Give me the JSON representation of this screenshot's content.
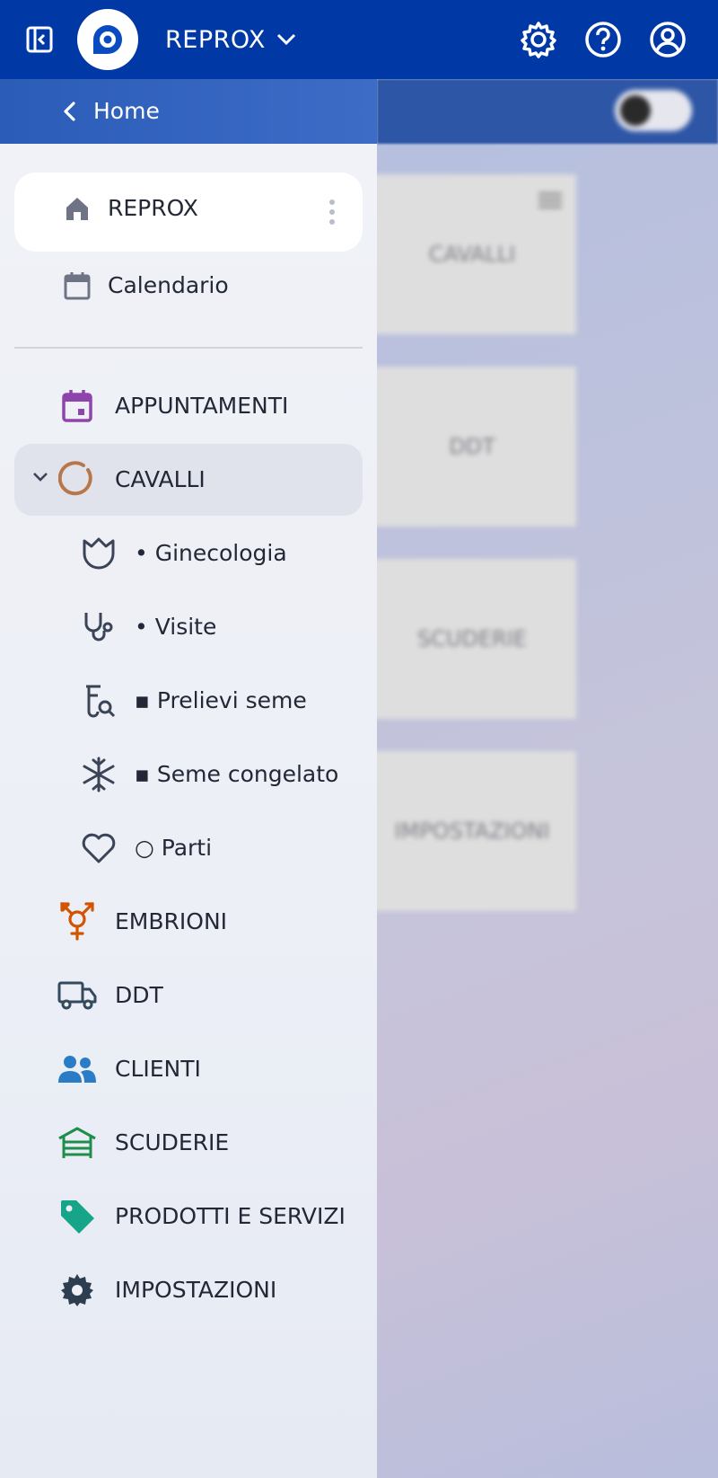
{
  "topbar": {
    "app_name": "REPROX",
    "icons": [
      "sidebar-collapse-icon",
      "logo-icon",
      "chevron-down-icon",
      "gear-icon",
      "help-icon",
      "account-icon"
    ]
  },
  "drawer": {
    "header_label": "Home",
    "pinned": [
      {
        "label": "REPROX",
        "icon": "home-icon"
      },
      {
        "label": "Calendario",
        "icon": "calendar-icon"
      }
    ],
    "items": [
      {
        "label": "APPUNTAMENTI",
        "icon": "calendar-event-icon",
        "color": "#8e44ad"
      },
      {
        "label": "CAVALLI",
        "icon": "horseshoe-icon",
        "color": "#b7774a",
        "expanded": true
      },
      {
        "label": "• Ginecologia",
        "icon": "tulip-icon",
        "color": "#3a4456"
      },
      {
        "label": "• Visite",
        "icon": "stethoscope-icon",
        "color": "#3a4456"
      },
      {
        "label": "▪ Prelievi seme",
        "icon": "test-tube-search-icon",
        "color": "#3a4456"
      },
      {
        "label": "▪ Seme congelato",
        "icon": "snowflake-icon",
        "color": "#3a4456"
      },
      {
        "label": "○ Parti",
        "icon": "heart-icon",
        "color": "#3a4456"
      },
      {
        "label": "EMBRIONI",
        "icon": "gender-icon",
        "color": "#d35400"
      },
      {
        "label": "DDT",
        "icon": "truck-icon",
        "color": "#34495e"
      },
      {
        "label": "CLIENTI",
        "icon": "users-icon",
        "color": "#2a7cc7"
      },
      {
        "label": "SCUDERIE",
        "icon": "warehouse-icon",
        "color": "#1e8e4a"
      },
      {
        "label": "PRODOTTI E SERVIZI",
        "icon": "tag-icon",
        "color": "#17a589"
      },
      {
        "label": "IMPOSTAZIONI",
        "icon": "settings-icon",
        "color": "#2c3e50"
      }
    ]
  },
  "background": {
    "cards": [
      "CAVALLI",
      "DDT",
      "SCUDERIE",
      "IMPOSTAZIONI"
    ]
  }
}
